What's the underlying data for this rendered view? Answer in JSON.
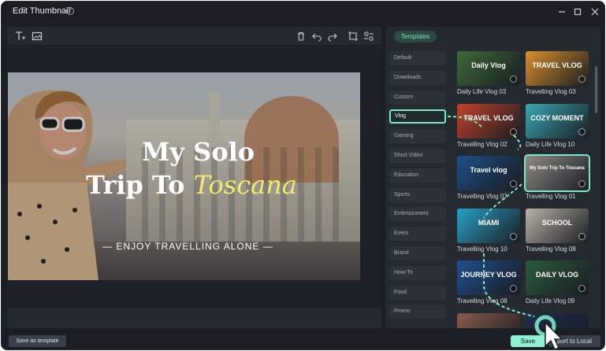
{
  "window": {
    "title": "Edit Thumbnail",
    "controls": [
      "minimize-icon",
      "maximize-icon",
      "close-icon"
    ]
  },
  "editor": {
    "toolbar_left": [
      "text-tool-icon",
      "image-tool-icon"
    ],
    "toolbar_right": [
      "delete-icon",
      "undo-icon",
      "redo-icon",
      "crop-icon",
      "settings-icon"
    ],
    "thumbnail": {
      "line1": "My Solo",
      "line2_plain": "Trip To ",
      "line2_highlight": "Toscana",
      "subtitle": "—   ENJOY TRAVELLING ALONE   —"
    }
  },
  "templates": {
    "tab_label": "Templates",
    "categories": [
      {
        "label": "Default",
        "active": false
      },
      {
        "label": "Downloads",
        "active": false
      },
      {
        "label": "Custom",
        "active": false
      },
      {
        "label": "Vlog",
        "active": true
      },
      {
        "label": "Gaming",
        "active": false
      },
      {
        "label": "Short Video",
        "active": false
      },
      {
        "label": "Education",
        "active": false
      },
      {
        "label": "Sports",
        "active": false
      },
      {
        "label": "Entertainment",
        "active": false
      },
      {
        "label": "Event",
        "active": false
      },
      {
        "label": "Brand",
        "active": false
      },
      {
        "label": "How-To",
        "active": false
      },
      {
        "label": "Food",
        "active": false
      },
      {
        "label": "Promo",
        "active": false
      }
    ],
    "cards": [
      {
        "label": "Daily Life Vlog 03",
        "art": "Daily Vlog",
        "bg": "#3e6b3a"
      },
      {
        "label": "Travelling Vlog 03",
        "art": "TRAVEL VLOG",
        "bg": "#d9902a"
      },
      {
        "label": "Travelling Vlog 02",
        "art": "TRAVEL VLOG",
        "bg": "#c2412a"
      },
      {
        "label": "Daily Life Vlog 10",
        "art": "COZY MOMENT",
        "bg": "#3aa7b3"
      },
      {
        "label": "Travelling Vlog 07",
        "art": "Travel vlog",
        "bg": "#1d4e86"
      },
      {
        "label": "Travelling Vlog 01",
        "art": "My Solo Trip To Toscana",
        "bg": "#8d8b86",
        "selected": true
      },
      {
        "label": "Travelling Vlog 10",
        "art": "MIAMI",
        "bg": "#2aa0c8"
      },
      {
        "label": "Travelling Vlog 08",
        "art": "SCHOOL",
        "bg": "#b9b2a8"
      },
      {
        "label": "Travelling Vlog 08",
        "art": "JOURNEY VLOG",
        "bg": "#1f4f8f"
      },
      {
        "label": "Daily Life Vlog 09",
        "art": "DAILY VLOG",
        "bg": "#2b5a3d"
      },
      {
        "label": "",
        "art": "",
        "bg": "#8a5a4a"
      },
      {
        "label": "",
        "art": "",
        "bg": "#1c2c4c"
      }
    ]
  },
  "footer": {
    "save_as_template": "Save as template",
    "save": "Save",
    "export": "port to Local"
  },
  "colors": {
    "accent": "#7ee8c6",
    "panel": "#252a31",
    "window": "#1b1f25"
  }
}
